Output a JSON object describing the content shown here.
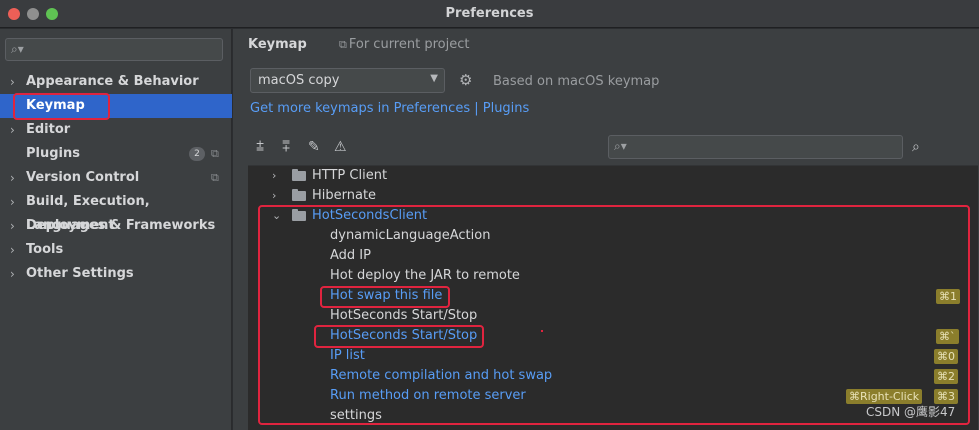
{
  "window": {
    "title": "Preferences"
  },
  "sidebar": {
    "search_placeholder": "",
    "items": [
      {
        "label": "Appearance & Behavior",
        "arrow": "›"
      },
      {
        "label": "Keymap",
        "arrow": ""
      },
      {
        "label": "Editor",
        "arrow": "›"
      },
      {
        "label": "Plugins",
        "arrow": "",
        "badge": "2"
      },
      {
        "label": "Version Control",
        "arrow": "›"
      },
      {
        "label": "Build, Execution, Deployment",
        "arrow": "›"
      },
      {
        "label": "Languages & Frameworks",
        "arrow": "›"
      },
      {
        "label": "Tools",
        "arrow": "›"
      },
      {
        "label": "Other Settings",
        "arrow": "›"
      }
    ]
  },
  "main": {
    "title": "Keymap",
    "project_hint": "For current project",
    "keymap_value": "macOS copy",
    "based_on": "Based on macOS keymap",
    "more_link": "Get more keymaps in Preferences | Plugins",
    "tree_search_placeholder": ""
  },
  "tree": [
    {
      "label": "HTTP Client",
      "type": "folder",
      "expanded": false,
      "twisty": "›"
    },
    {
      "label": "Hibernate",
      "type": "folder",
      "expanded": false,
      "twisty": "›"
    },
    {
      "label": "HotSecondsClient",
      "type": "folder",
      "expanded": true,
      "twisty": "⌄"
    },
    {
      "label": "dynamicLanguageAction",
      "type": "action",
      "shortcut": ""
    },
    {
      "label": "Add IP",
      "type": "action",
      "shortcut": ""
    },
    {
      "label": "Hot deploy the JAR to remote",
      "type": "action",
      "shortcut": ""
    },
    {
      "label": "Hot swap this file",
      "type": "action",
      "shortcut": "⌘1"
    },
    {
      "label": "HotSeconds Start/Stop",
      "type": "action",
      "shortcut": ""
    },
    {
      "label": "HotSeconds Start/Stop",
      "type": "action",
      "shortcut": "⌘`"
    },
    {
      "label": "IP list",
      "type": "action",
      "shortcut": "⌘0"
    },
    {
      "label": "Remote compilation and hot swap",
      "type": "action",
      "shortcut": "⌘2"
    },
    {
      "label": "Run method on remote server",
      "type": "action",
      "shortcut": "⌘3",
      "extra_shortcut": "⌘Right-Click"
    },
    {
      "label": "settings",
      "type": "action",
      "shortcut": ""
    }
  ],
  "watermark": "CSDN @鹰影47",
  "colors": {
    "accent": "#2f65ca",
    "link": "#589df6",
    "highlight": "#e0243f",
    "shortcut_bg": "#8b7e2c"
  }
}
